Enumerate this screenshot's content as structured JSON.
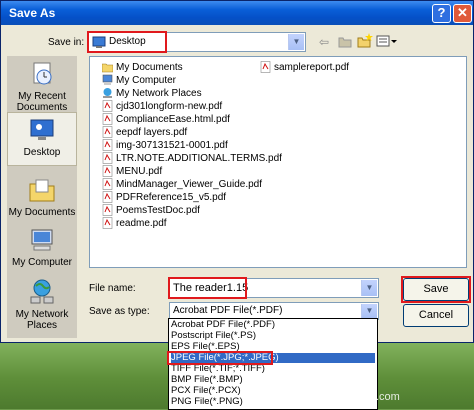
{
  "window": {
    "title": "Save As",
    "help_glyph": "?",
    "close_glyph": "✕"
  },
  "save_in": {
    "label": "Save in:",
    "value": "Desktop"
  },
  "places": [
    {
      "label": "My Recent Documents",
      "icon": "recent-documents-icon"
    },
    {
      "label": "Desktop",
      "icon": "desktop-icon"
    },
    {
      "label": "My Documents",
      "icon": "my-documents-icon"
    },
    {
      "label": "My Computer",
      "icon": "my-computer-icon"
    },
    {
      "label": "My Network Places",
      "icon": "network-places-icon"
    }
  ],
  "files": [
    {
      "name": "My Documents",
      "icon": "folder"
    },
    {
      "name": "My Computer",
      "icon": "computer"
    },
    {
      "name": "My Network Places",
      "icon": "network"
    },
    {
      "name": "cjd301longform-new.pdf",
      "icon": "pdf"
    },
    {
      "name": "ComplianceEase.html.pdf",
      "icon": "pdf"
    },
    {
      "name": "eepdf layers.pdf",
      "icon": "pdf"
    },
    {
      "name": "img-307131521-0001.pdf",
      "icon": "pdf"
    },
    {
      "name": "LTR.NOTE.ADDITIONAL.TERMS.pdf",
      "icon": "pdf"
    },
    {
      "name": "MENU.pdf",
      "icon": "pdf"
    },
    {
      "name": "MindManager_Viewer_Guide.pdf",
      "icon": "pdf"
    },
    {
      "name": "PDFReference15_v5.pdf",
      "icon": "pdf"
    },
    {
      "name": "PoemsTestDoc.pdf",
      "icon": "pdf"
    },
    {
      "name": "readme.pdf",
      "icon": "pdf"
    },
    {
      "name": "samplereport.pdf",
      "icon": "pdf"
    }
  ],
  "file_name": {
    "label": "File name:",
    "value": "The reader1.15"
  },
  "save_as_type": {
    "label": "Save as type:",
    "value": "Acrobat PDF File(*.PDF)",
    "options": [
      "Acrobat PDF File(*.PDF)",
      "Postscript File(*.PS)",
      "EPS File(*.EPS)",
      "JPEG File(*.JPG;*.JPEG)",
      "TIFF File(*.TIF;*.TIFF)",
      "BMP File(*.BMP)",
      "PCX File(*.PCX)",
      "PNG File(*.PNG)"
    ],
    "highlighted": "JPEG File(*.JPG;*.JPEG)"
  },
  "buttons": {
    "save": "Save",
    "cancel": "Cancel"
  },
  "watermark": "© VeryPDF.com",
  "colors": {
    "title_bar": "#0a5fd8",
    "highlight": "#316ac5",
    "annotation": "#e0191d"
  }
}
